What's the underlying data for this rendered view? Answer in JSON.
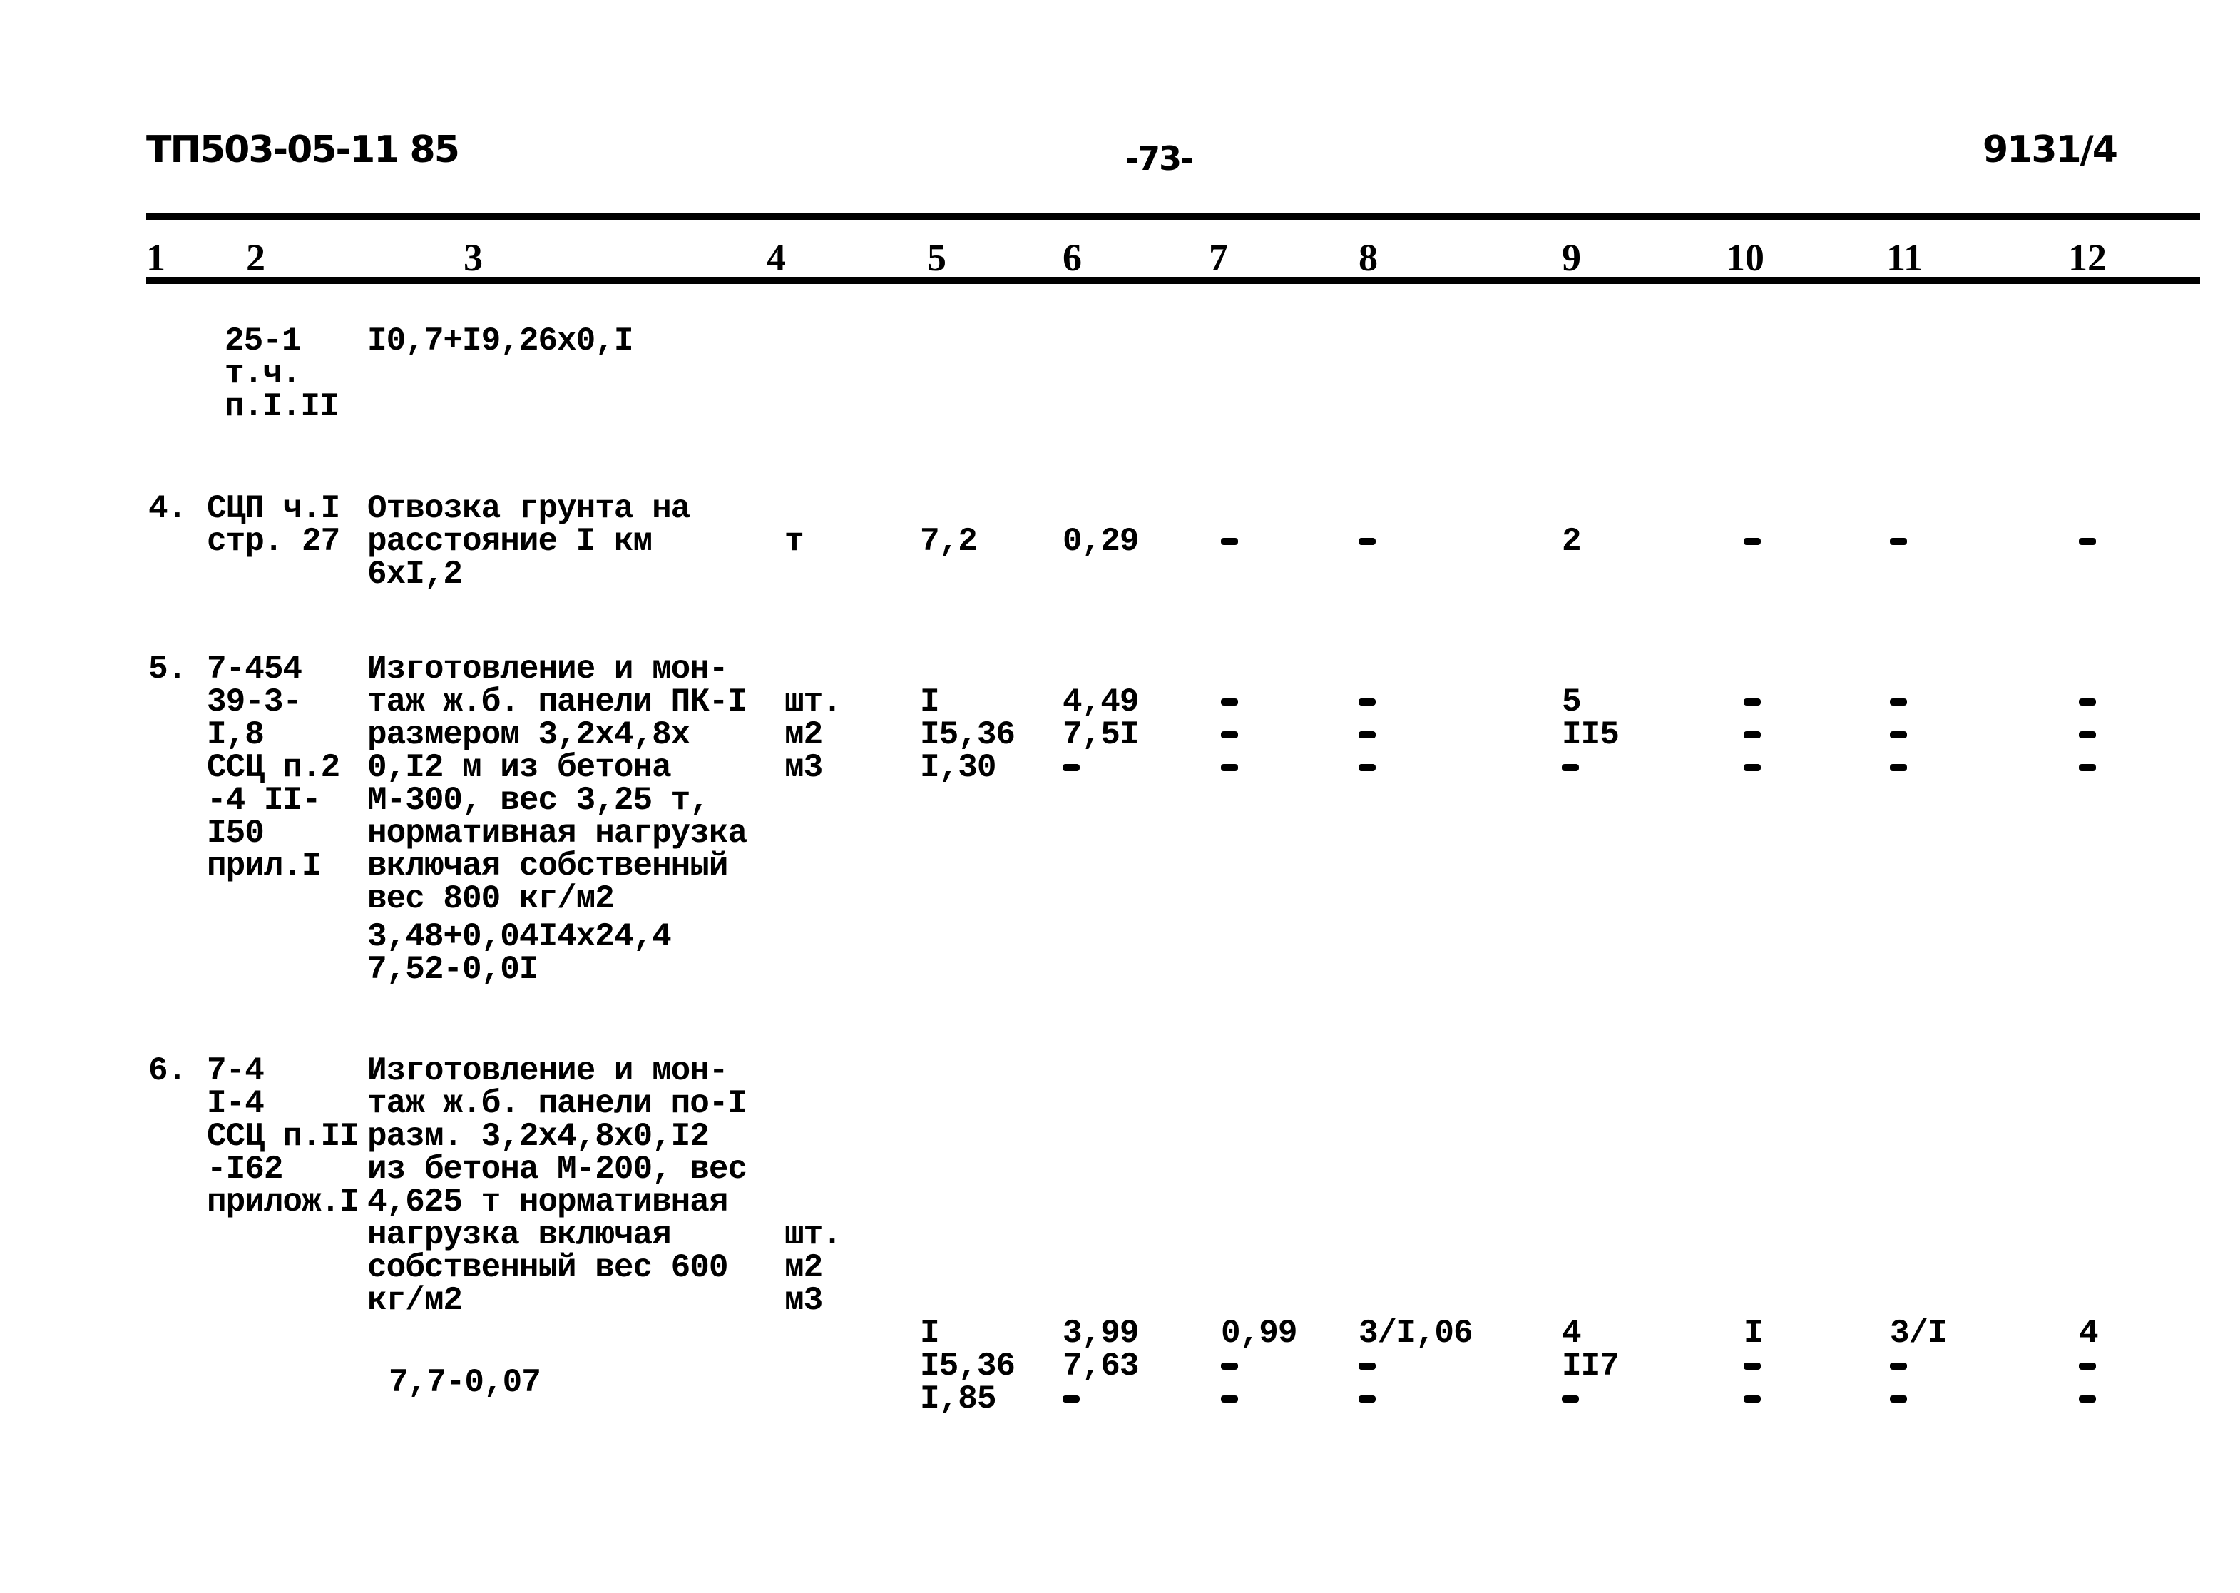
{
  "header": {
    "doc_code": "ТП503-05-11 85",
    "page_number": "-73-",
    "sheet_ref": "9131/4"
  },
  "column_numbers": [
    "1",
    "2",
    "3",
    "4",
    "5",
    "6",
    "7",
    "8",
    "9",
    "10",
    "11",
    "12"
  ],
  "rows": [
    {
      "no": "",
      "code": [
        "25-1",
        "т.ч.",
        "п.I.II"
      ],
      "description": [
        "I0,7+I9,26x0,I"
      ],
      "unit": [],
      "c5": [],
      "c6": [],
      "c7": [],
      "c8": [],
      "c9": [],
      "c10": [],
      "c11": [],
      "c12": [],
      "calc": []
    },
    {
      "no": "4.",
      "code": [
        "СЦП ч.I",
        "стр. 27"
      ],
      "description": [
        "Отвозка грунта на",
        "расстояние I км",
        "6xI,2"
      ],
      "unit": [
        "т"
      ],
      "c5": [
        "7,2"
      ],
      "c6": [
        "0,29"
      ],
      "c7": [
        "-"
      ],
      "c8": [
        "-"
      ],
      "c9": [
        "2"
      ],
      "c10": [
        "-"
      ],
      "c11": [
        "-"
      ],
      "c12": [
        "-"
      ],
      "calc": []
    },
    {
      "no": "5.",
      "code": [
        "7-454",
        "39-3-",
        "I,8",
        "ССЦ п.2",
        "-4 II-",
        "I50",
        "прил.I"
      ],
      "description": [
        "Изготовление и мон-",
        "таж ж.б. панели ПК-I",
        "размером 3,2x4,8x",
        "0,I2 м из бетона",
        "М-300, вес 3,25 т,",
        "нормативная нагрузка",
        "включая собственный",
        "вес 800 кг/м2"
      ],
      "unit": [
        "шт.",
        "м2",
        "м3"
      ],
      "c5": [
        "I",
        "I5,36",
        "I,30"
      ],
      "c6": [
        "4,49",
        "7,5I",
        "-"
      ],
      "c7": [
        "-",
        "-",
        "-"
      ],
      "c8": [
        "-",
        "-",
        "-"
      ],
      "c9": [
        "5",
        "II5",
        "-"
      ],
      "c10": [
        "-",
        "-",
        "-"
      ],
      "c11": [
        "-",
        "-",
        "-"
      ],
      "c12": [
        "-",
        "-",
        "-"
      ],
      "calc": [
        "3,48+0,04I4x24,4",
        "7,52-0,0I"
      ]
    },
    {
      "no": "6.",
      "code": [
        "7-4",
        "I-4",
        "ССЦ п.II",
        "-I62",
        "прилож.I"
      ],
      "description": [
        "Изготовление и мон-",
        "таж ж.б. панели по-I",
        "разм. 3,2x4,8x0,I2",
        "из бетона М-200, вес",
        "4,625 т нормативная",
        "нагрузка включая",
        "собственный вес 600",
        "кг/м2"
      ],
      "unit": [
        "шт.",
        "м2",
        "м3"
      ],
      "c5": [
        "I",
        "I5,36",
        "I,85"
      ],
      "c6": [
        "3,99",
        "7,63",
        "-"
      ],
      "c7": [
        "0,99",
        "-",
        "-"
      ],
      "c8": [
        "3/I,06",
        "-",
        "-"
      ],
      "c9": [
        "4",
        "II7",
        "-"
      ],
      "c10": [
        "I",
        "-",
        "-"
      ],
      "c11": [
        "3/I",
        "-",
        "-"
      ],
      "c12": [
        "4",
        "-",
        "-"
      ],
      "calc": [
        "7,7-0,07"
      ]
    }
  ]
}
